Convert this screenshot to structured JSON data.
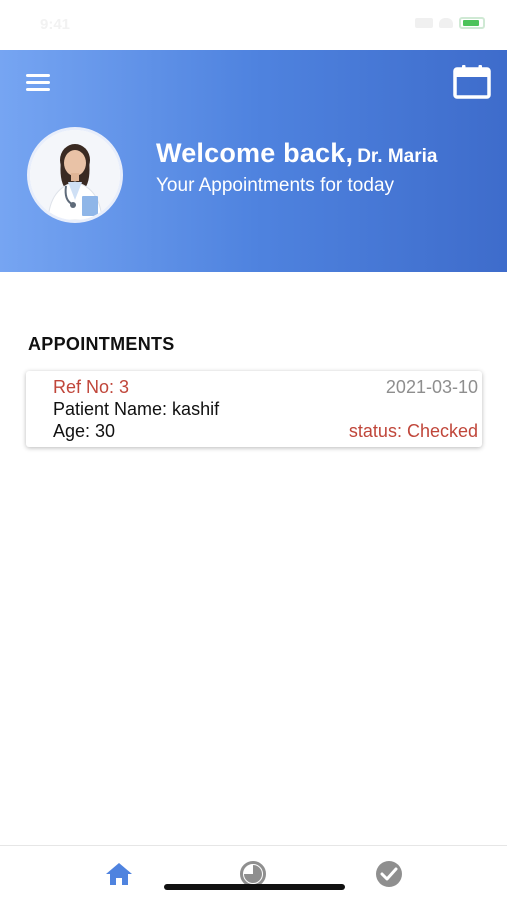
{
  "status_bar": {
    "time": "9:41"
  },
  "header": {
    "welcome": "Welcome back,",
    "doctor_name": "Dr. Maria",
    "subtitle": "Your Appointments for today"
  },
  "appointments": {
    "section_title": "APPOINTMENTS",
    "items": [
      {
        "ref": "Ref No: 3",
        "date": "2021-03-10",
        "patient": "Patient Name: kashif",
        "age": "Age: 30",
        "status": "status: Checked"
      }
    ]
  },
  "tabbar": {
    "tabs": [
      "home-icon",
      "history-icon",
      "check-icon"
    ]
  },
  "colors": {
    "accent": "#4f83df",
    "ref": "#c0463a",
    "date": "#8e8e8e",
    "tab_active": "#4f83df",
    "tab_inactive": "#8f8f8f"
  }
}
